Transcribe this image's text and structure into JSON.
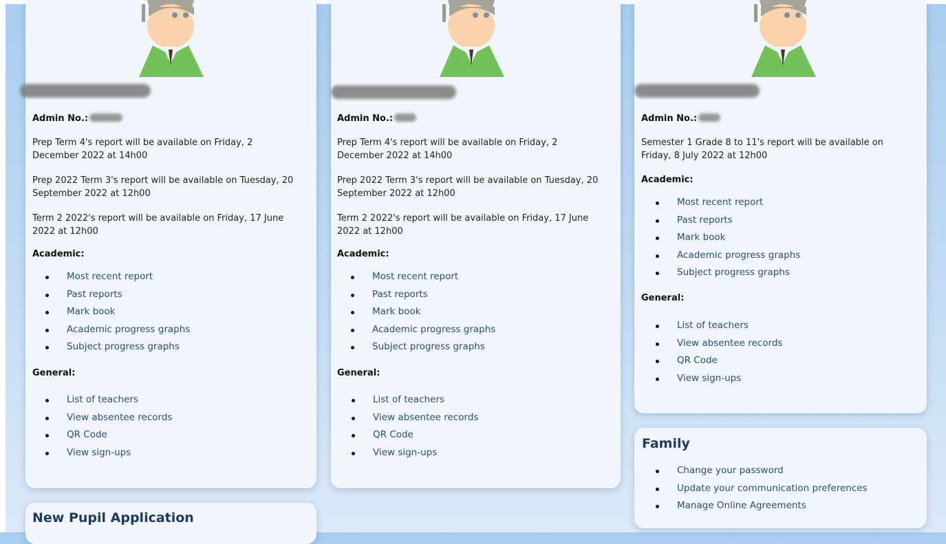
{
  "students": [
    {
      "admin_label": "Admin No.:",
      "notices": [
        "Prep Term 4's report will be available on Friday, 2 December 2022 at 14h00",
        "Prep 2022 Term 3's report will be available on Tuesday, 20 September 2022 at 12h00",
        "Term 2 2022's report will be available on Friday, 17 June 2022 at 12h00"
      ],
      "academic_heading": "Academic:",
      "academic_links": [
        "Most recent report",
        "Past reports",
        "Mark book",
        "Academic progress graphs",
        "Subject progress graphs"
      ],
      "general_heading": "General:",
      "general_links": [
        "List of teachers",
        "View absentee records",
        "QR Code",
        "View sign-ups"
      ]
    },
    {
      "admin_label": "Admin No.:",
      "notices": [
        "Prep Term 4's report will be available on Friday, 2 December 2022 at 14h00",
        "Prep 2022 Term 3's report will be available on Tuesday, 20 September 2022 at 12h00",
        "Term 2 2022's report will be available on Friday, 17 June 2022 at 12h00"
      ],
      "academic_heading": "Academic:",
      "academic_links": [
        "Most recent report",
        "Past reports",
        "Mark book",
        "Academic progress graphs",
        "Subject progress graphs"
      ],
      "general_heading": "General:",
      "general_links": [
        "List of teachers",
        "View absentee records",
        "QR Code",
        "View sign-ups"
      ]
    },
    {
      "admin_label": "Admin No.:",
      "notices": [
        "Semester 1 Grade 8 to 11's report will be available on Friday, 8 July 2022 at 12h00"
      ],
      "academic_heading": "Academic:",
      "academic_links": [
        "Most recent report",
        "Past reports",
        "Mark book",
        "Academic progress graphs",
        "Subject progress graphs"
      ],
      "general_heading": "General:",
      "general_links": [
        "List of teachers",
        "View absentee records",
        "QR Code",
        "View sign-ups"
      ]
    }
  ],
  "family": {
    "title": "Family",
    "links": [
      "Change your password",
      "Update your communication preferences",
      "Manage Online Agreements"
    ]
  },
  "new_pupil": {
    "title": "New Pupil Application"
  }
}
